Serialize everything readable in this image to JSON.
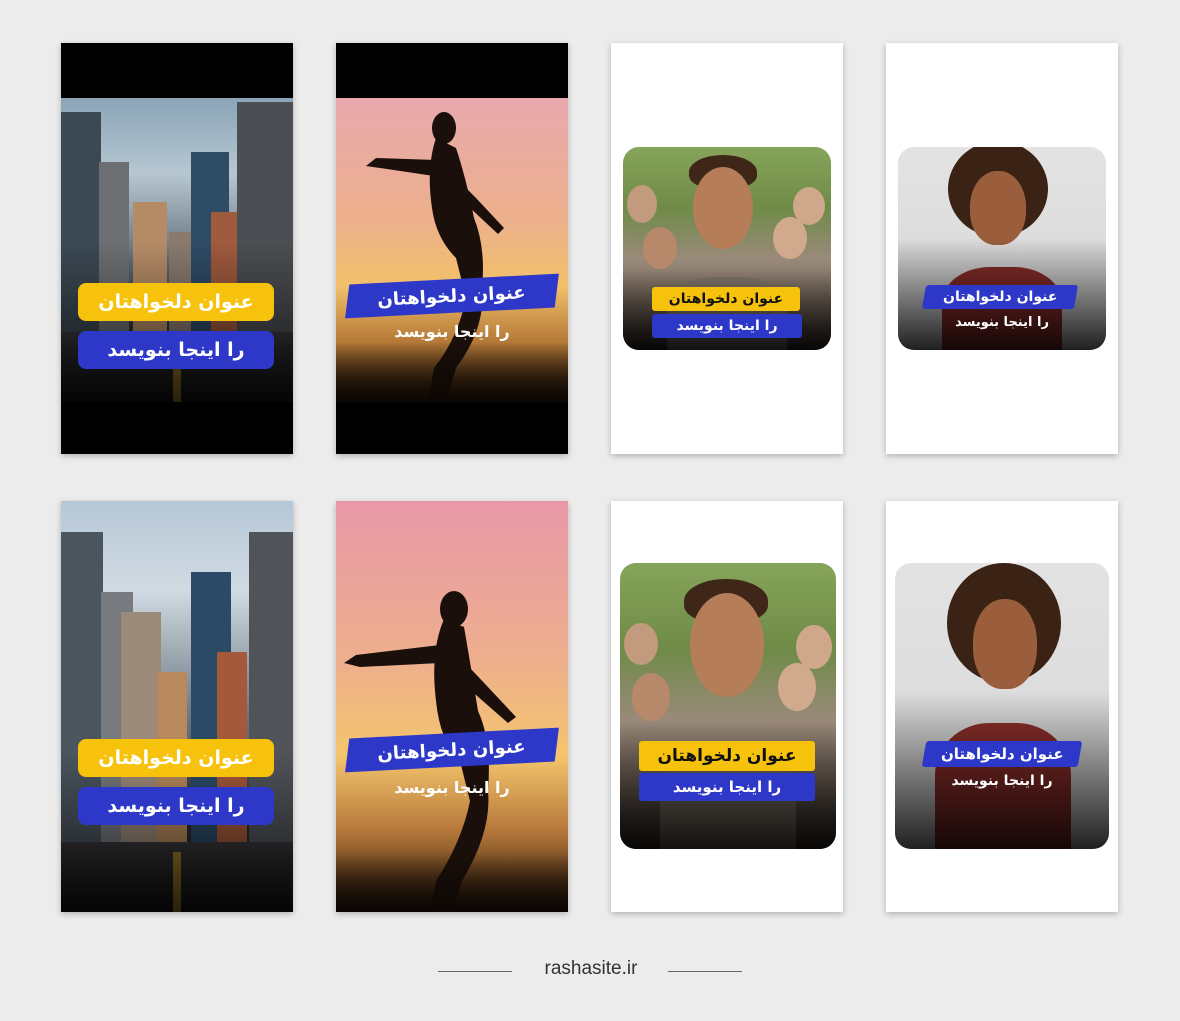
{
  "cards": {
    "title": "عنوان دلخواهتان",
    "subtitle": "را اینجا بنویسد"
  },
  "footer": {
    "site": "rashasite.ir"
  },
  "colors": {
    "accent_yellow": "#f7c20b",
    "accent_blue": "#2d38c8",
    "page_bg": "#ececec"
  }
}
